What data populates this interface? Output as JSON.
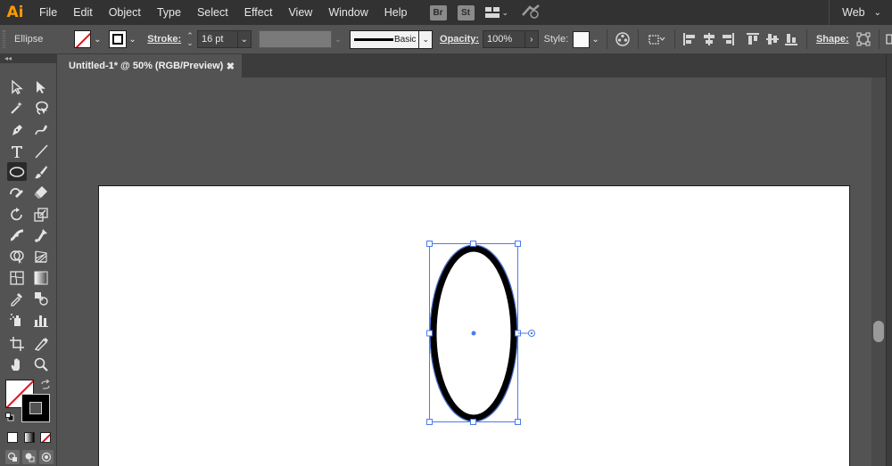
{
  "app": {
    "logo": "Ai"
  },
  "menu": {
    "items": [
      "File",
      "Edit",
      "Object",
      "Type",
      "Select",
      "Effect",
      "View",
      "Window",
      "Help"
    ],
    "bridge_badge": "Br",
    "stock_badge": "St",
    "workspace": "Web"
  },
  "control_bar": {
    "selection_type": "Ellipse",
    "stroke_label": "Stroke:",
    "stroke_weight": "16 pt",
    "profile_label": "Basic",
    "opacity_label": "Opacity:",
    "opacity_value": "100%",
    "style_label": "Style:",
    "shape_label": "Shape:"
  },
  "toolbar": {
    "header": "◂◂"
  },
  "document": {
    "tab_title": "Untitled-1* @ 50% (RGB/Preview)",
    "close_glyph": "✖"
  },
  "colors": {
    "menubar_bg": "#323232",
    "panel_bg": "#535353",
    "selection_blue": "#4b7bec",
    "logo_orange": "#ff9a00",
    "none_swatch_red": "#e0121c"
  },
  "icons": {
    "menu": [
      "bridge-icon",
      "stock-icon",
      "arrange-documents-icon",
      "gpu-performance-icon"
    ],
    "tools": [
      "selection-tool-icon",
      "direct-selection-tool-icon",
      "magic-wand-tool-icon",
      "lasso-tool-icon",
      "pen-tool-icon",
      "curvature-tool-icon",
      "type-tool-icon",
      "line-segment-tool-icon",
      "ellipse-tool-icon",
      "paintbrush-tool-icon",
      "shaper-tool-icon",
      "eraser-tool-icon",
      "rotate-tool-icon",
      "scale-tool-icon",
      "width-tool-icon",
      "puppet-warp-tool-icon",
      "shape-builder-tool-icon",
      "perspective-grid-tool-icon",
      "mesh-tool-icon",
      "gradient-tool-icon",
      "eyedropper-tool-icon",
      "blend-tool-icon",
      "symbol-sprayer-tool-icon",
      "column-graph-tool-icon",
      "artboard-tool-icon",
      "slice-tool-icon",
      "hand-tool-icon",
      "zoom-tool-icon"
    ]
  }
}
